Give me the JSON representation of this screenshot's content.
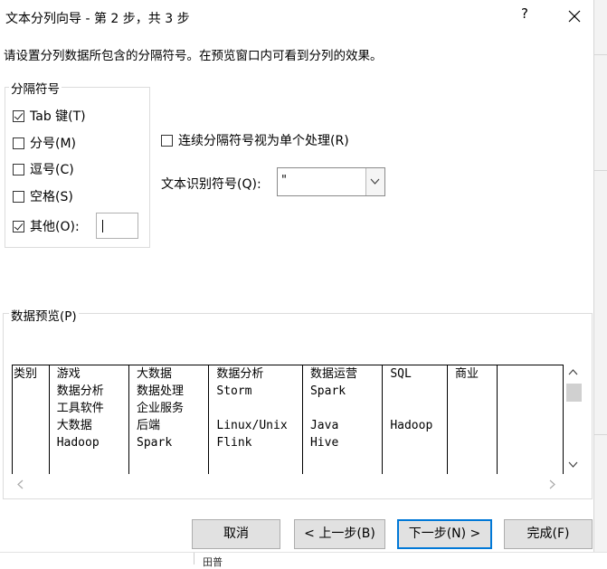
{
  "window": {
    "title": "文本分列向导 - 第 2 步，共 3 步",
    "help_label": "?"
  },
  "instruction": "请设置分列数据所包含的分隔符号。在预览窗口内可看到分列的效果。",
  "delimiters": {
    "legend": "分隔符号",
    "tab": {
      "label": "Tab 键(T)",
      "checked": true
    },
    "semicolon": {
      "label": "分号(M)",
      "checked": false
    },
    "comma": {
      "label": "逗号(C)",
      "checked": false
    },
    "space": {
      "label": "空格(S)",
      "checked": false
    },
    "other": {
      "label": "其他(O):",
      "checked": true,
      "value": ""
    }
  },
  "consecutive": {
    "label": "连续分隔符号视为单个处理(R)",
    "checked": false
  },
  "text_qualifier": {
    "label": "文本识别符号(Q):",
    "value": "\""
  },
  "preview": {
    "legend": "数据预览(P)",
    "columns": [
      [
        "类别"
      ],
      [
        "游戏",
        "数据分析",
        "工具软件",
        "大数据",
        "Hadoop"
      ],
      [
        "大数据",
        "数据处理",
        "企业服务",
        "后端",
        "Spark"
      ],
      [
        "数据分析",
        "Storm",
        "",
        "Linux/Unix",
        "Flink"
      ],
      [
        "数据运营",
        "Spark",
        "",
        "Java",
        "Hive"
      ],
      [
        "SQL",
        "",
        "",
        "Hadoop",
        ""
      ],
      [
        "商业"
      ],
      []
    ]
  },
  "buttons": {
    "cancel": "取消",
    "back": "< 上一步(B)",
    "next": "下一步(N) >",
    "finish": "完成(F)"
  },
  "background_fragment": "田普"
}
